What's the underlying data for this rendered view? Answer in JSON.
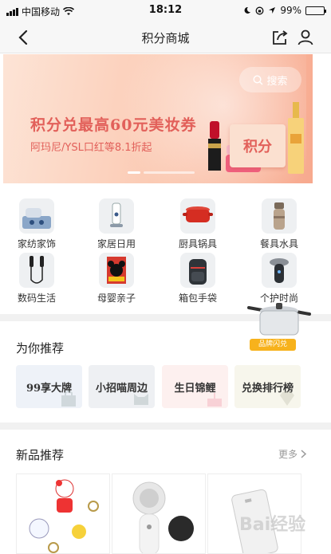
{
  "status_bar": {
    "carrier": "中国移动",
    "time": "18:12",
    "battery": "99%"
  },
  "nav": {
    "title": "积分商城"
  },
  "banner": {
    "search_label": "搜索",
    "headline": "积分兑最高60元美妆券",
    "subline": "阿玛尼/YSL口红等8.1折起",
    "card_text": "积分"
  },
  "categories": [
    {
      "label": "家纺家饰",
      "icon": "bedding-icon"
    },
    {
      "label": "家居日用",
      "icon": "home-goods-icon"
    },
    {
      "label": "厨具锅具",
      "icon": "pot-icon"
    },
    {
      "label": "餐具水具",
      "icon": "thermos-icon"
    },
    {
      "label": "数码生活",
      "icon": "earphones-icon"
    },
    {
      "label": "母婴亲子",
      "icon": "kids-book-icon"
    },
    {
      "label": "箱包手袋",
      "icon": "backpack-icon"
    },
    {
      "label": "个护时尚",
      "icon": "shaver-icon"
    }
  ],
  "floating_promo": {
    "badge": "品牌闪兑",
    "icon": "pressure-cooker-icon"
  },
  "recommend": {
    "title": "为你推荐",
    "cards": [
      {
        "label": "99享大牌",
        "bg": "#eef2f8"
      },
      {
        "label": "小招喵周边",
        "bg": "#eef0f3"
      },
      {
        "label": "生日锦鲤",
        "bg": "#fdf0ef"
      },
      {
        "label": "兑换排行榜",
        "bg": "#f7f6ec"
      }
    ]
  },
  "new_products": {
    "title": "新品推荐",
    "more_label": "更多",
    "items": [
      {
        "icon": "hello-kitty-keychain-icon"
      },
      {
        "icon": "facial-brush-icon"
      },
      {
        "icon": "power-bank-icon"
      }
    ]
  },
  "watermark": "Bai经验"
}
